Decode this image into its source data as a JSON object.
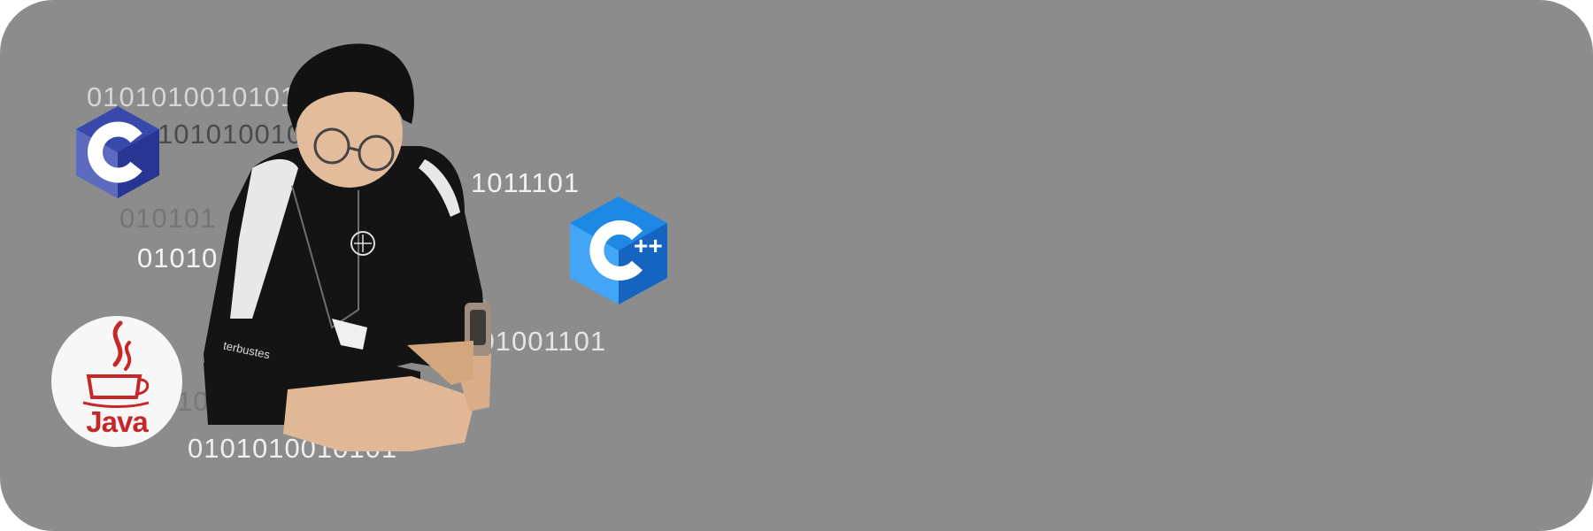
{
  "binary_lines": [
    "0101010010101",
    "1010100101",
    "1011101",
    "010101",
    "01010",
    "01",
    "0101001101",
    "10",
    "0101010010101"
  ],
  "logos": {
    "c": "c-language-logo",
    "cpp": "cpp-language-logo",
    "cpp_plus": "++",
    "java_text": "Java"
  },
  "hoodie_text": "terbustes",
  "colors": {
    "background": "#8c8c8c",
    "c_logo": "#3f51b5",
    "cpp_logo": "#1e88e5",
    "java_logo": "#c62828"
  }
}
